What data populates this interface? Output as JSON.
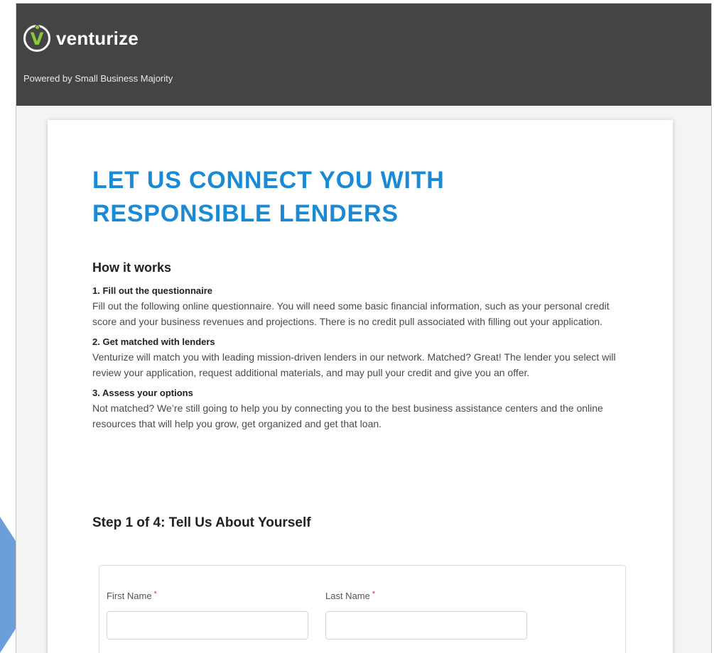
{
  "header": {
    "brand": "venturize",
    "logo_letter": "V",
    "tagline": "Powered by Small Business Majority",
    "background": "#444444",
    "brand_accent": "#8cc63f"
  },
  "main": {
    "title": "LET US CONNECT YOU WITH RESPONSIBLE LENDERS",
    "title_color": "#1a8ad6",
    "how_heading": "How it works",
    "steps": [
      {
        "title": "1. Fill out the questionnaire",
        "body": "Fill out the following online questionnaire. You will need some basic financial information, such as your personal credit score and your business revenues and projections. There is no credit pull associated with filling out your application."
      },
      {
        "title": "2. Get matched with lenders",
        "body": "Venturize will match you with leading mission-driven lenders in our network. Matched? Great! The lender you select will review your application, request additional materials, and may pull your credit and give you an offer."
      },
      {
        "title": "3. Assess your options",
        "body": "Not matched? We’re still going to help you by connecting you to the best business assistance centers and the online resources that will help you grow, get organized and get that loan."
      }
    ],
    "step_heading": "Step 1 of 4: Tell Us About Yourself"
  },
  "form": {
    "first_name_label": "First Name",
    "last_name_label": "Last Name",
    "required_marker": "*",
    "first_name_value": "",
    "last_name_value": ""
  },
  "annotation": {
    "arrow_icon": "arrow-right-icon",
    "arrow_color": "#6b9fd9"
  }
}
